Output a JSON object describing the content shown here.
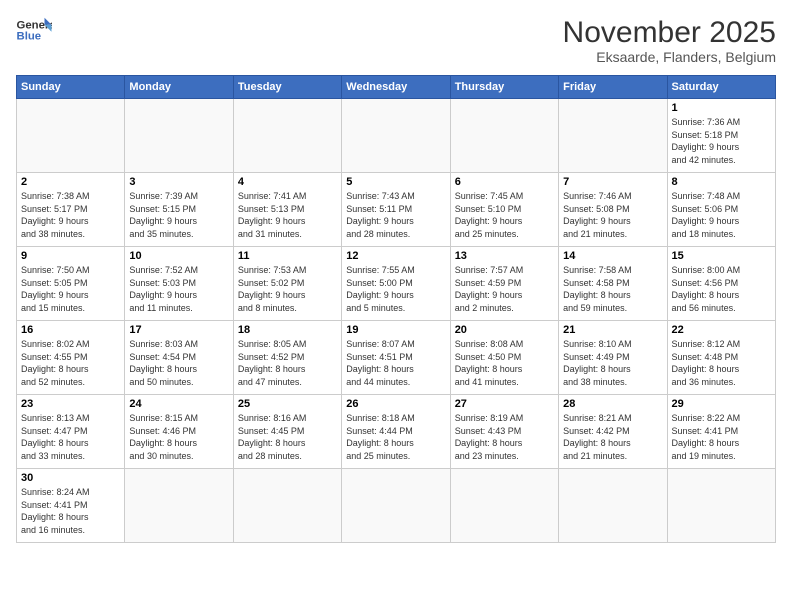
{
  "logo": {
    "text_general": "General",
    "text_blue": "Blue"
  },
  "header": {
    "month": "November 2025",
    "location": "Eksaarde, Flanders, Belgium"
  },
  "weekdays": [
    "Sunday",
    "Monday",
    "Tuesday",
    "Wednesday",
    "Thursday",
    "Friday",
    "Saturday"
  ],
  "weeks": [
    [
      {
        "day": "",
        "info": ""
      },
      {
        "day": "",
        "info": ""
      },
      {
        "day": "",
        "info": ""
      },
      {
        "day": "",
        "info": ""
      },
      {
        "day": "",
        "info": ""
      },
      {
        "day": "",
        "info": ""
      },
      {
        "day": "1",
        "info": "Sunrise: 7:36 AM\nSunset: 5:18 PM\nDaylight: 9 hours\nand 42 minutes."
      }
    ],
    [
      {
        "day": "2",
        "info": "Sunrise: 7:38 AM\nSunset: 5:17 PM\nDaylight: 9 hours\nand 38 minutes."
      },
      {
        "day": "3",
        "info": "Sunrise: 7:39 AM\nSunset: 5:15 PM\nDaylight: 9 hours\nand 35 minutes."
      },
      {
        "day": "4",
        "info": "Sunrise: 7:41 AM\nSunset: 5:13 PM\nDaylight: 9 hours\nand 31 minutes."
      },
      {
        "day": "5",
        "info": "Sunrise: 7:43 AM\nSunset: 5:11 PM\nDaylight: 9 hours\nand 28 minutes."
      },
      {
        "day": "6",
        "info": "Sunrise: 7:45 AM\nSunset: 5:10 PM\nDaylight: 9 hours\nand 25 minutes."
      },
      {
        "day": "7",
        "info": "Sunrise: 7:46 AM\nSunset: 5:08 PM\nDaylight: 9 hours\nand 21 minutes."
      },
      {
        "day": "8",
        "info": "Sunrise: 7:48 AM\nSunset: 5:06 PM\nDaylight: 9 hours\nand 18 minutes."
      }
    ],
    [
      {
        "day": "9",
        "info": "Sunrise: 7:50 AM\nSunset: 5:05 PM\nDaylight: 9 hours\nand 15 minutes."
      },
      {
        "day": "10",
        "info": "Sunrise: 7:52 AM\nSunset: 5:03 PM\nDaylight: 9 hours\nand 11 minutes."
      },
      {
        "day": "11",
        "info": "Sunrise: 7:53 AM\nSunset: 5:02 PM\nDaylight: 9 hours\nand 8 minutes."
      },
      {
        "day": "12",
        "info": "Sunrise: 7:55 AM\nSunset: 5:00 PM\nDaylight: 9 hours\nand 5 minutes."
      },
      {
        "day": "13",
        "info": "Sunrise: 7:57 AM\nSunset: 4:59 PM\nDaylight: 9 hours\nand 2 minutes."
      },
      {
        "day": "14",
        "info": "Sunrise: 7:58 AM\nSunset: 4:58 PM\nDaylight: 8 hours\nand 59 minutes."
      },
      {
        "day": "15",
        "info": "Sunrise: 8:00 AM\nSunset: 4:56 PM\nDaylight: 8 hours\nand 56 minutes."
      }
    ],
    [
      {
        "day": "16",
        "info": "Sunrise: 8:02 AM\nSunset: 4:55 PM\nDaylight: 8 hours\nand 52 minutes."
      },
      {
        "day": "17",
        "info": "Sunrise: 8:03 AM\nSunset: 4:54 PM\nDaylight: 8 hours\nand 50 minutes."
      },
      {
        "day": "18",
        "info": "Sunrise: 8:05 AM\nSunset: 4:52 PM\nDaylight: 8 hours\nand 47 minutes."
      },
      {
        "day": "19",
        "info": "Sunrise: 8:07 AM\nSunset: 4:51 PM\nDaylight: 8 hours\nand 44 minutes."
      },
      {
        "day": "20",
        "info": "Sunrise: 8:08 AM\nSunset: 4:50 PM\nDaylight: 8 hours\nand 41 minutes."
      },
      {
        "day": "21",
        "info": "Sunrise: 8:10 AM\nSunset: 4:49 PM\nDaylight: 8 hours\nand 38 minutes."
      },
      {
        "day": "22",
        "info": "Sunrise: 8:12 AM\nSunset: 4:48 PM\nDaylight: 8 hours\nand 36 minutes."
      }
    ],
    [
      {
        "day": "23",
        "info": "Sunrise: 8:13 AM\nSunset: 4:47 PM\nDaylight: 8 hours\nand 33 minutes."
      },
      {
        "day": "24",
        "info": "Sunrise: 8:15 AM\nSunset: 4:46 PM\nDaylight: 8 hours\nand 30 minutes."
      },
      {
        "day": "25",
        "info": "Sunrise: 8:16 AM\nSunset: 4:45 PM\nDaylight: 8 hours\nand 28 minutes."
      },
      {
        "day": "26",
        "info": "Sunrise: 8:18 AM\nSunset: 4:44 PM\nDaylight: 8 hours\nand 25 minutes."
      },
      {
        "day": "27",
        "info": "Sunrise: 8:19 AM\nSunset: 4:43 PM\nDaylight: 8 hours\nand 23 minutes."
      },
      {
        "day": "28",
        "info": "Sunrise: 8:21 AM\nSunset: 4:42 PM\nDaylight: 8 hours\nand 21 minutes."
      },
      {
        "day": "29",
        "info": "Sunrise: 8:22 AM\nSunset: 4:41 PM\nDaylight: 8 hours\nand 19 minutes."
      }
    ],
    [
      {
        "day": "30",
        "info": "Sunrise: 8:24 AM\nSunset: 4:41 PM\nDaylight: 8 hours\nand 16 minutes."
      },
      {
        "day": "",
        "info": ""
      },
      {
        "day": "",
        "info": ""
      },
      {
        "day": "",
        "info": ""
      },
      {
        "day": "",
        "info": ""
      },
      {
        "day": "",
        "info": ""
      },
      {
        "day": "",
        "info": ""
      }
    ]
  ]
}
